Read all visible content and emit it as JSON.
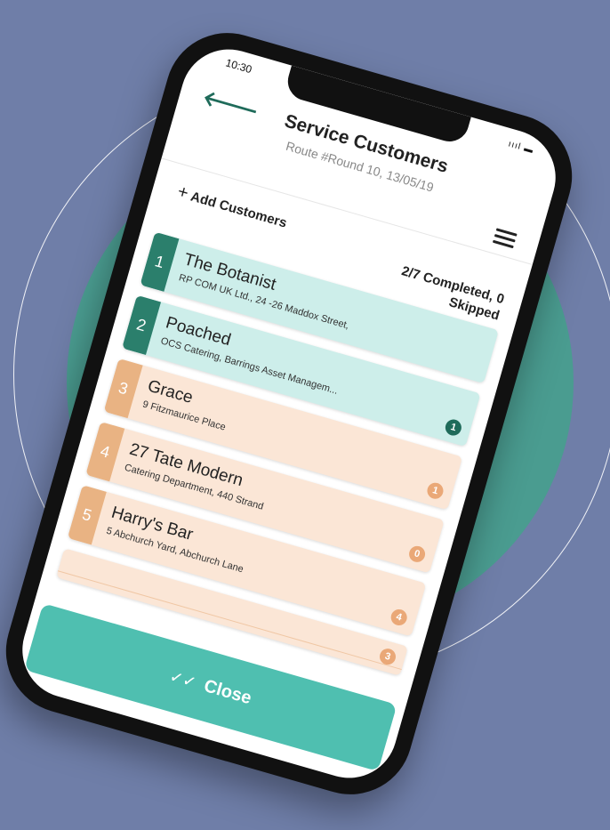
{
  "status": {
    "time": "10:30",
    "signal": "ıııl ▬"
  },
  "header": {
    "title": "Service Customers",
    "subtitle": "Route #Round 10, 13/05/19"
  },
  "toolbar": {
    "add_label": "Add Customers",
    "progress_text": "2/7 Completed, 0 Skipped"
  },
  "customers": [
    {
      "num": "1",
      "name": "The Botanist",
      "address": "RP COM UK Ltd., 24 -26 Maddox Street,",
      "badge": "",
      "state": "done"
    },
    {
      "num": "2",
      "name": "Poached",
      "address": "OCS Catering, Barrings Asset Managem...",
      "badge": "1",
      "state": "done"
    },
    {
      "num": "3",
      "name": "Grace",
      "address": "9 Fitzmaurice Place",
      "badge": "1",
      "state": "todo"
    },
    {
      "num": "4",
      "name": "27 Tate Modern",
      "address": "Catering Department, 440 Strand",
      "badge": "0",
      "state": "todo"
    },
    {
      "num": "5",
      "name": "Harry's Bar",
      "address": "5 Abchurch Yard, Abchurch Lane",
      "badge": "4",
      "state": "todo"
    },
    {
      "num": "",
      "name": "",
      "address": "",
      "badge": "3",
      "state": "todo"
    }
  ],
  "footer": {
    "close_label": "Close"
  },
  "colors": {
    "background": "#6f7ea8",
    "blob": "#4a9c90",
    "done_accent": "#2b7f6c",
    "todo_accent": "#e9b383",
    "close_button": "#4fbfb0"
  }
}
